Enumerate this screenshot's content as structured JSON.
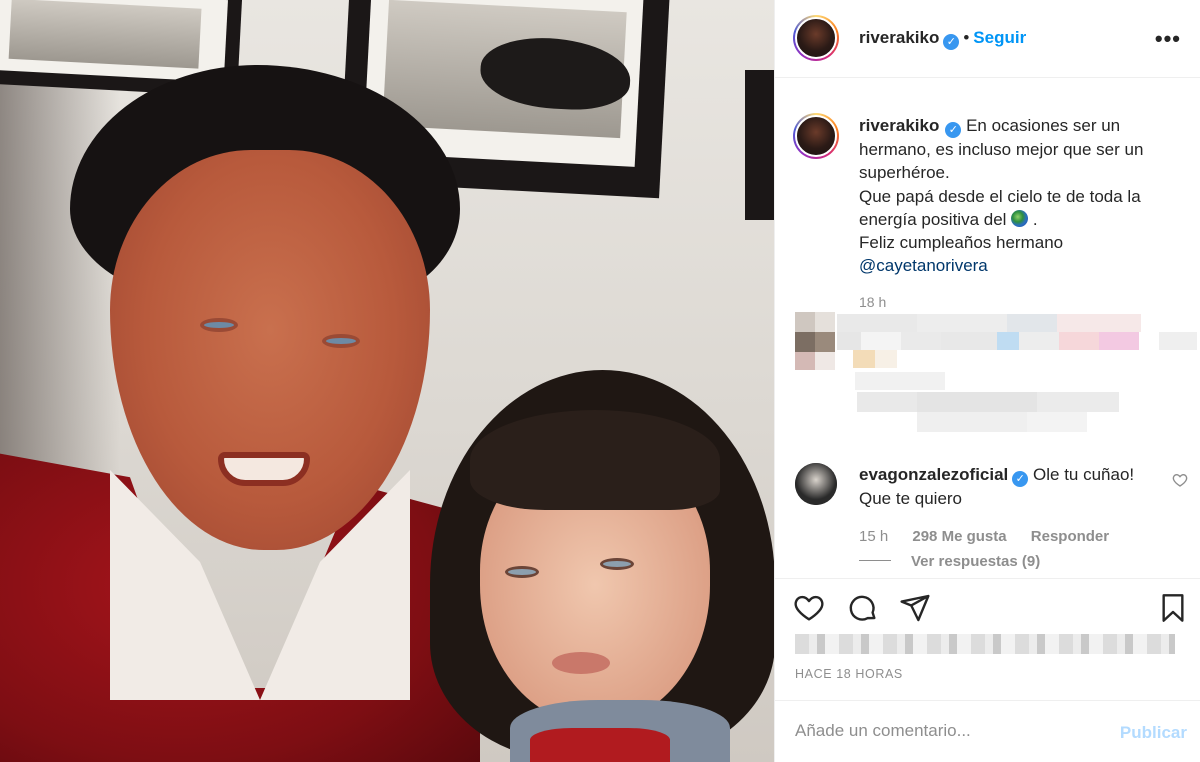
{
  "post": {
    "username": "riverakiko",
    "follow_label": "Seguir",
    "more_label": "•••",
    "verified_mark": "✓",
    "dot_separator": "•",
    "caption_lines": [
      "En ocasiones ser un hermano, es incluso mejor que ser un superhéroe.",
      "Que papá desde el cielo te de toda la energía positiva del",
      "Feliz cumpleaños hermano"
    ],
    "caption_end": ".",
    "caption_mention": "@cayetanorivera",
    "caption_time": "18 h",
    "posted_ago": "HACE 18 HORAS"
  },
  "comment": {
    "username": "evagonzalezoficial",
    "text": "Ole tu cuñao! Que te quiero",
    "time": "15 h",
    "likes": "298 Me gusta",
    "reply_label": "Responder",
    "view_replies": "Ver respuestas (9)"
  },
  "comment_box": {
    "placeholder": "Añade un comentario...",
    "publish_label": "Publicar"
  },
  "icons": {
    "like": "heart-icon",
    "comment": "comment-icon",
    "share": "paper-plane-icon",
    "save": "bookmark-icon",
    "caption_emoji": "globe-emoji-icon"
  },
  "colors": {
    "link_blue": "#0095f6",
    "verified_blue": "#3897f0",
    "publish_disabled": "#b3dbff",
    "muted_text": "#8e8e8e"
  }
}
